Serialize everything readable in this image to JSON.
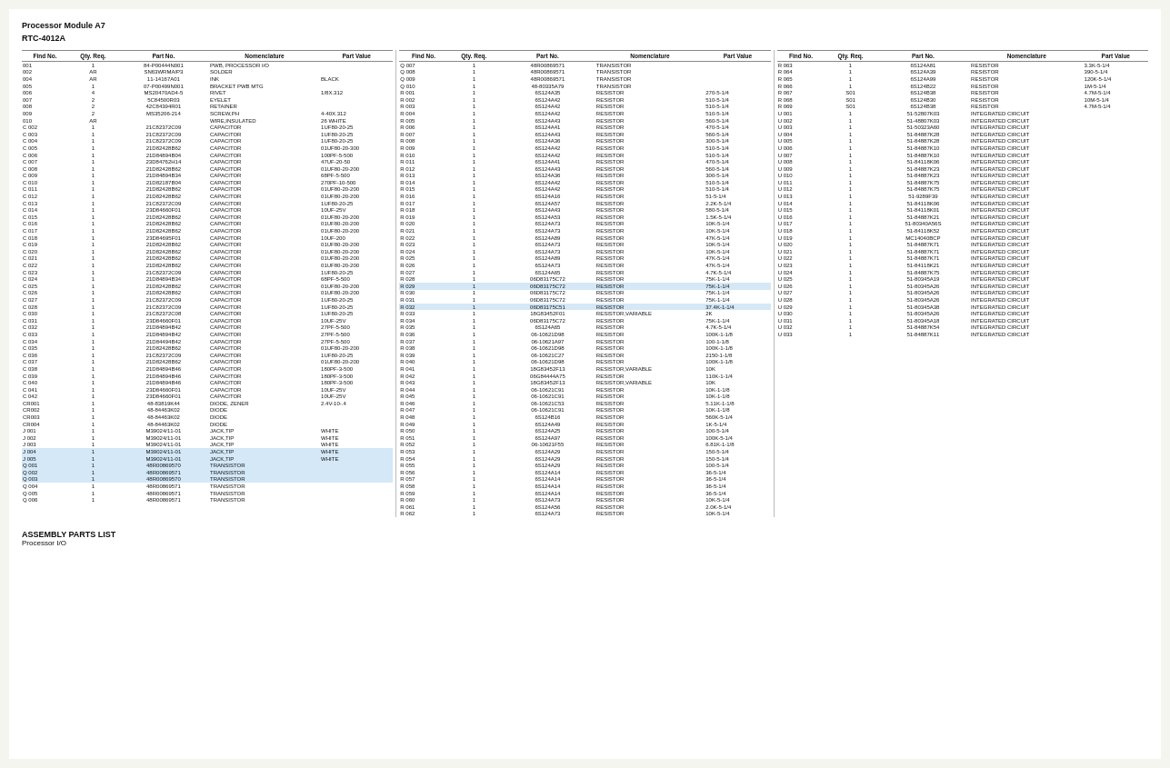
{
  "title": "Processor Module A7",
  "subtitle": "RTC-4012A",
  "column_headers": {
    "find_no": "Find No.",
    "qty_req": "Qty. Req.",
    "part_no": "Part No.",
    "nomenclature": "Nomenclature",
    "part_value": "Part Value"
  },
  "footer": {
    "main": "ASSEMBLY PARTS LIST",
    "sub": "Processor I/O"
  },
  "col1_rows": [
    [
      "001",
      "1",
      "84-P00444N001",
      "PWB, PROCESSOR I/O",
      ""
    ],
    [
      "002",
      "AR",
      "SN63WRMA/P3",
      "SOLDER",
      ""
    ],
    [
      "004",
      "AR",
      "11-14167A01",
      "INK",
      "BLACK"
    ],
    [
      "005",
      "1",
      "07-P00499N001",
      "BRACKET PWB MTG",
      ""
    ],
    [
      "006",
      "4",
      "MS20470AD4-5",
      "RIVET",
      "1/8X.312"
    ],
    [
      "007",
      "2",
      "5C84500R03",
      "EYELET",
      ""
    ],
    [
      "008",
      "2",
      "42C84394R01",
      "RETAINER",
      ""
    ],
    [
      "009",
      "2",
      "MS35206-214",
      "SCREW,PH",
      "4-40X.312"
    ],
    [
      "010",
      "AR",
      "",
      "WIRE,INSULATED",
      "26 WHITE"
    ],
    [
      "C 002",
      "1",
      "21C82372C09",
      "CAPACITOR",
      "1UF80-20-25"
    ],
    [
      "C 003",
      "1",
      "21C82372C09",
      "CAPACITOR",
      "1UF80-20-25"
    ],
    [
      "C 004",
      "1",
      "21C82372C09",
      "CAPACITOR",
      "1UF80-20-25"
    ],
    [
      "C 005",
      "1",
      "21D82428B62",
      "CAPACITOR",
      "01UF80-20-300"
    ],
    [
      "C 006",
      "1",
      "21D84894B04",
      "CAPACITOR",
      "100PF-5-500"
    ],
    [
      "C 007",
      "1",
      "23D84762H14",
      "CAPACITOR",
      "47UF-20-50"
    ],
    [
      "C 008",
      "1",
      "21D82428B62",
      "CAPACITOR",
      "01UF80-20-200"
    ],
    [
      "C 009",
      "1",
      "21D84894B34",
      "CAPACITOR",
      "68PF-5-500"
    ],
    [
      "C 010",
      "1",
      "21D82187B04",
      "CAPACITOR",
      "270PF-10-500"
    ],
    [
      "C 011",
      "1",
      "21D82428B62",
      "CAPACITOR",
      "01UF80-20-200"
    ],
    [
      "C 012",
      "1",
      "21D82428B62",
      "CAPACITOR",
      "01UF80-20-200"
    ],
    [
      "C 013",
      "1",
      "21C82372C09",
      "CAPACITOR",
      "1UF80-20-25"
    ],
    [
      "C 014",
      "1",
      "23D84660F01",
      "CAPACITOR",
      "10UF-25V"
    ],
    [
      "C 015",
      "1",
      "21D82428B62",
      "CAPACITOR",
      "01UF80-20-200"
    ],
    [
      "C 016",
      "1",
      "21D82428B62",
      "CAPACITOR",
      "01UF80-20-200"
    ],
    [
      "C 017",
      "1",
      "21D82428B62",
      "CAPACITOR",
      "01UF80-20-200"
    ],
    [
      "C 018",
      "1",
      "23D84695F01",
      "CAPACITOR",
      "10UF-200"
    ],
    [
      "C 019",
      "1",
      "21D82428B62",
      "CAPACITOR",
      "01UF80-20-200"
    ],
    [
      "C 020",
      "1",
      "21D82428B62",
      "CAPACITOR",
      "01UF80-20-200"
    ],
    [
      "C 021",
      "1",
      "21D82428B62",
      "CAPACITOR",
      "01UF80-20-200"
    ],
    [
      "C 022",
      "1",
      "21D82428B62",
      "CAPACITOR",
      "01UF80-20-200"
    ],
    [
      "C 023",
      "1",
      "21C82372C09",
      "CAPACITOR",
      "1UF80-20-25"
    ],
    [
      "C 024",
      "1",
      "21D84894B34",
      "CAPACITOR",
      "68PF-5-500"
    ],
    [
      "C 025",
      "1",
      "21D82428B62",
      "CAPACITOR",
      "01UF80-20-200"
    ],
    [
      "C 026",
      "1",
      "21D82428B62",
      "CAPACITOR",
      "01UF80-20-200"
    ],
    [
      "C 027",
      "1",
      "21C82372C09",
      "CAPACITOR",
      "1UF80-20-25"
    ],
    [
      "C 028",
      "1",
      "21C82372C09",
      "CAPACITOR",
      "1UF80-20-25"
    ],
    [
      "C 030",
      "1",
      "21C82372C08",
      "CAPACITOR",
      "1UF80-20-25"
    ],
    [
      "C 031",
      "1",
      "23D84660F01",
      "CAPACITOR",
      "10UF-25V"
    ],
    [
      "C 032",
      "1",
      "21D84894B42",
      "CAPACITOR",
      "27PF-5-500"
    ],
    [
      "C 033",
      "1",
      "21D84894B42",
      "CAPACITOR",
      "27PF-5-500"
    ],
    [
      "C 034",
      "1",
      "21D84494B42",
      "CAPACITOR",
      "27PF-5-500"
    ],
    [
      "C 035",
      "1",
      "21D82428B62",
      "CAPACITOR",
      "01UF80-20-200"
    ],
    [
      "C 036",
      "1",
      "21C82372C09",
      "CAPACITOR",
      "1UF80-20-25"
    ],
    [
      "C 037",
      "1",
      "21D82428B62",
      "CAPACITOR",
      "01UF80-20-200"
    ],
    [
      "C 038",
      "1",
      "21D84894B46",
      "CAPACITOR",
      "180PF-3-500"
    ],
    [
      "C 039",
      "1",
      "21D84894B46",
      "CAPACITOR",
      "180PF-3-500"
    ],
    [
      "C 040",
      "1",
      "21D84894B46",
      "CAPACITOR",
      "180PF-3-500"
    ],
    [
      "C 041",
      "1",
      "23D84660F01",
      "CAPACITOR",
      "10UF-25V"
    ],
    [
      "C 042",
      "1",
      "23D84660F01",
      "CAPACITOR",
      "10UF-25V"
    ],
    [
      "CR001",
      "1",
      "48-83819K44",
      "DIODE, ZENER",
      "2.4V-10-.4"
    ],
    [
      "CR002",
      "1",
      "48-84463K02",
      "DIODE",
      ""
    ],
    [
      "CR003",
      "1",
      "48-84463K02",
      "DIODE",
      ""
    ],
    [
      "CR004",
      "1",
      "48-84463K02",
      "DIODE",
      ""
    ],
    [
      "J 001",
      "1",
      "M39024/11-01",
      "JACK,TIP",
      "WHITE"
    ],
    [
      "J 002",
      "1",
      "M39024/11-01",
      "JACK,TIP",
      "WHITE"
    ],
    [
      "J 003",
      "1",
      "M39024/11-01",
      "JACK,TIP",
      "WHITE"
    ],
    [
      "J 004",
      "1",
      "M39024/11-01",
      "JACK,TIP",
      "WHITE"
    ],
    [
      "J 005",
      "1",
      "M39024/11-01",
      "JACK,TIP",
      "WHITE"
    ],
    [
      "Q 001",
      "1",
      "48R00869570",
      "TRANSISTOR",
      ""
    ],
    [
      "Q 002",
      "1",
      "48R00869571",
      "TRANSISTOR",
      ""
    ],
    [
      "Q 003",
      "1",
      "48R00869570",
      "TRANSISTOR",
      ""
    ],
    [
      "Q 004",
      "1",
      "48R00869571",
      "TRANSISTOR",
      ""
    ],
    [
      "Q 005",
      "1",
      "48R00869571",
      "TRANSISTOR",
      ""
    ],
    [
      "Q 006",
      "1",
      "48R00869571",
      "TRANSISTOR",
      ""
    ]
  ],
  "col2_rows": [
    [
      "Q 007",
      "1",
      "48R00869571",
      "TRANSISTOR",
      ""
    ],
    [
      "Q 008",
      "1",
      "48R00869571",
      "TRANSISTOR",
      ""
    ],
    [
      "Q 009",
      "1",
      "48R00869571",
      "TRANSISTOR",
      ""
    ],
    [
      "Q 010",
      "1",
      "48-80335A79",
      "TRANSISTOR",
      ""
    ],
    [
      "R 001",
      "1",
      "6S124A35",
      "RESISTOR",
      "270-5-1/4"
    ],
    [
      "R 002",
      "1",
      "6S124A42",
      "RESISTOR",
      "510-5-1/4"
    ],
    [
      "R 003",
      "1",
      "6S124A42",
      "RESISTOR",
      "510-5-1/4"
    ],
    [
      "R 004",
      "1",
      "6S124A42",
      "RESISTOR",
      "510-5-1/4"
    ],
    [
      "R 005",
      "1",
      "6S124A43",
      "RESISTOR",
      "560-5-1/4"
    ],
    [
      "R 006",
      "1",
      "6S124A41",
      "RESISTOR",
      "470-5-1/4"
    ],
    [
      "R 007",
      "1",
      "6S124A43",
      "RESISTOR",
      "560-5-1/4"
    ],
    [
      "R 008",
      "1",
      "6S124A36",
      "RESISTOR",
      "300-5-1/4"
    ],
    [
      "R 009",
      "1",
      "6S124A42",
      "RESISTOR",
      "510-5-1/4"
    ],
    [
      "R 010",
      "1",
      "6S124A42",
      "RESISTOR",
      "510-5-1/4"
    ],
    [
      "R 011",
      "1",
      "6S124A41",
      "RESISTOR",
      "470-5-1/4"
    ],
    [
      "R 012",
      "1",
      "6S124A43",
      "RESISTOR",
      "560-5-1/4"
    ],
    [
      "R 013",
      "1",
      "6S124A36",
      "RESISTOR",
      "300-5-1/4"
    ],
    [
      "R 014",
      "1",
      "6S124A42",
      "RESISTOR",
      "510-5-1/4"
    ],
    [
      "R 015",
      "1",
      "6S124A42",
      "RESISTOR",
      "510-5-1/4"
    ],
    [
      "R 016",
      "1",
      "6S124A16",
      "RESISTOR",
      "51-5-1/4"
    ],
    [
      "R 017",
      "1",
      "6S124A57",
      "RESISTOR",
      "2.2K-5-1/4"
    ],
    [
      "R 018",
      "1",
      "6S124A43",
      "RESISTOR",
      "580-5-1/4"
    ],
    [
      "R 019",
      "1",
      "6S124A53",
      "RESISTOR",
      "1.5K-5-1/4"
    ],
    [
      "R 020",
      "1",
      "6S124A73",
      "RESISTOR",
      "10K-5-1/4"
    ],
    [
      "R 021",
      "1",
      "6S124A73",
      "RESISTOR",
      "10K-5-1/4"
    ],
    [
      "R 022",
      "1",
      "6S124A89",
      "RESISTOR",
      "47K-5-1/4"
    ],
    [
      "R 023",
      "1",
      "6S124A73",
      "RESISTOR",
      "10K-5-1/4"
    ],
    [
      "R 024",
      "1",
      "6S124A73",
      "RESISTOR",
      "10K-5-1/4"
    ],
    [
      "R 025",
      "1",
      "6S124A89",
      "RESISTOR",
      "47K-5-1/4"
    ],
    [
      "R 026",
      "1",
      "6S124A73",
      "RESISTOR",
      "47K-5-1/4"
    ],
    [
      "R 027",
      "1",
      "6S124A65",
      "RESISTOR",
      "4.7K-5-1/4"
    ],
    [
      "R 028",
      "1",
      "06D83175C72",
      "RESISTOR",
      "75K-1-1/4"
    ],
    [
      "R 029",
      "1",
      "06D83175C72",
      "RESISTOR",
      "75K-1-1/4"
    ],
    [
      "R 030",
      "1",
      "06D83175C72",
      "RESISTOR",
      "75K-1-1/4"
    ],
    [
      "R 031",
      "1",
      "06D83175C72",
      "RESISTOR",
      "75K-1-1/4"
    ],
    [
      "R 032",
      "1",
      "06D83175C51",
      "RESISTOR",
      "37.4K-1-1/4"
    ],
    [
      "R 033",
      "1",
      "18G83452F01",
      "RESISTOR,VARIABLE",
      "2K"
    ],
    [
      "R 034",
      "1",
      "06D83175C72",
      "RESISTOR",
      "75K-1-1/4"
    ],
    [
      "R 035",
      "1",
      "6S124A65",
      "RESISTOR",
      "4.7K-5-1/4"
    ],
    [
      "R 036",
      "1",
      "06-10621D98",
      "RESISTOR",
      "100K-1-1/8"
    ],
    [
      "R 037",
      "1",
      "06-10621A97",
      "RESISTOR",
      "100-1-1/8"
    ],
    [
      "R 038",
      "1",
      "06-10621D98",
      "RESISTOR",
      "100K-1-1/8"
    ],
    [
      "R 039",
      "1",
      "06-10621C27",
      "RESISTOR",
      "2150-1-1/8"
    ],
    [
      "R 040",
      "1",
      "06-10621D98",
      "RESISTOR",
      "100K-1-1/8"
    ],
    [
      "R 041",
      "1",
      "18G83452F13",
      "RESISTOR,VARIABLE",
      "10K"
    ],
    [
      "R 042",
      "1",
      "06G84444A75",
      "RESISTOR",
      "110K-1-1/4"
    ],
    [
      "R 043",
      "1",
      "18G83452F13",
      "RESISTOR,VARIABLE",
      "10K"
    ],
    [
      "R 044",
      "1",
      "06-10621C91",
      "RESISTOR",
      "10K-1-1/8"
    ],
    [
      "R 045",
      "1",
      "06-10621C91",
      "RESISTOR",
      "10K-1-1/8"
    ],
    [
      "R 046",
      "1",
      "06-10621C53",
      "RESISTOR",
      "5.11K-1-1/8"
    ],
    [
      "R 047",
      "1",
      "06-10621C91",
      "RESISTOR",
      "10K-1-1/8"
    ],
    [
      "R 048",
      "1",
      "6S124B16",
      "RESISTOR",
      "560K-5-1/4"
    ],
    [
      "R 049",
      "1",
      "6S124A49",
      "RESISTOR",
      "1K-5-1/4"
    ],
    [
      "R 050",
      "1",
      "6S124A25",
      "RESISTOR",
      "100-5-1/4"
    ],
    [
      "R 051",
      "1",
      "6S124A97",
      "RESISTOR",
      "100K-5-1/4"
    ],
    [
      "R 052",
      "1",
      "06-10621F55",
      "RESISTOR",
      "6.81K-1-1/8"
    ],
    [
      "R 053",
      "1",
      "6S124A29",
      "RESISTOR",
      "150-5-1/4"
    ],
    [
      "R 054",
      "1",
      "6S124A29",
      "RESISTOR",
      "150-5-1/4"
    ],
    [
      "R 055",
      "1",
      "6S124A29",
      "RESISTOR",
      "100-5-1/4"
    ],
    [
      "R 056",
      "1",
      "6S124A14",
      "RESISTOR",
      "36-5-1/4"
    ],
    [
      "R 057",
      "1",
      "6S124A14",
      "RESISTOR",
      "36-5-1/4"
    ],
    [
      "R 058",
      "1",
      "6S124A14",
      "RESISTOR",
      "36-5-1/4"
    ],
    [
      "R 059",
      "1",
      "6S124A14",
      "RESISTOR",
      "36-5-1/4"
    ],
    [
      "R 060",
      "1",
      "6S124A73",
      "RESISTOR",
      "10K-5-1/4"
    ],
    [
      "R 061",
      "1",
      "6S124A56",
      "RESISTOR",
      "2.0K-5-1/4"
    ],
    [
      "R 062",
      "1",
      "6S124A73",
      "RESISTOR",
      "10K-5-1/4"
    ]
  ],
  "col3_rows": [
    [
      "R 063",
      "1",
      "6S124A81",
      "RESISTOR",
      "3.3K-5-1/4"
    ],
    [
      "R 064",
      "1",
      "6S124A39",
      "RESISTOR",
      "390-5-1/4"
    ],
    [
      "R 065",
      "1",
      "6S124A99",
      "RESISTOR",
      "120K-5-1/4"
    ],
    [
      "R 066",
      "1",
      "6S124B22",
      "RESISTOR",
      "1M-5-1/4"
    ],
    [
      "R 067",
      "S01",
      "6S124B38",
      "RESISTOR",
      "4.7M-5-1/4"
    ],
    [
      "R 068",
      "S01",
      "6S124B30",
      "RESISTOR",
      "10M-5-1/4"
    ],
    [
      "R 069",
      "S01",
      "6S124B38",
      "RESISTOR",
      "4.7M-5-1/4"
    ],
    [
      "U 001",
      "1",
      "51-52807K03",
      "INTEGRATED CIRCUIT",
      ""
    ],
    [
      "U 002",
      "1",
      "51-48807K03",
      "INTEGRATED CIRCUIT",
      ""
    ],
    [
      "U 003",
      "1",
      "51-50323A60",
      "INTEGRATED CIRCUIT",
      ""
    ],
    [
      "U 004",
      "1",
      "51-84887K28",
      "INTEGRATED CIRCUIT",
      ""
    ],
    [
      "U 005",
      "1",
      "51-84887K28",
      "INTEGRATED CIRCUIT",
      ""
    ],
    [
      "U 006",
      "1",
      "51-84887K10",
      "INTEGRATED CIRCUIT",
      ""
    ],
    [
      "U 007",
      "1",
      "51-84887K10",
      "INTEGRATED CIRCUIT",
      ""
    ],
    [
      "U 008",
      "1",
      "51-84118K06",
      "INTEGRATED CIRCUIT",
      ""
    ],
    [
      "U 009",
      "1",
      "51-84887K23",
      "INTEGRATED CIRCUIT",
      ""
    ],
    [
      "U 010",
      "1",
      "51-84887K23",
      "INTEGRATED CIRCUIT",
      ""
    ],
    [
      "U 011",
      "1",
      "51-84887K75",
      "INTEGRATED CIRCUIT",
      ""
    ],
    [
      "U 012",
      "1",
      "51-84887K75",
      "INTEGRATED CIRCUIT",
      ""
    ],
    [
      "U 013",
      "1",
      "51-9289F39",
      "INTEGRATED CIRCUIT",
      ""
    ],
    [
      "U 014",
      "1",
      "51-84118K06",
      "INTEGRATED CIRCUIT",
      ""
    ],
    [
      "U 015",
      "1",
      "51-84118K01",
      "INTEGRATED CIRCUIT",
      ""
    ],
    [
      "U 016",
      "1",
      "51-84887K21",
      "INTEGRATED CIRCUIT",
      ""
    ],
    [
      "U 017",
      "1",
      "51-80340A56S",
      "INTEGRATED CIRCUIT",
      ""
    ],
    [
      "U 018",
      "1",
      "51-84118K52",
      "INTEGRATED CIRCUIT",
      ""
    ],
    [
      "U 019",
      "1",
      "MC14040BCP",
      "INTEGRATED CIRCUIT",
      ""
    ],
    [
      "U 020",
      "1",
      "51-84887K71",
      "INTEGRATED CIRCUIT",
      ""
    ],
    [
      "U 021",
      "1",
      "51-84887K71",
      "INTEGRATED CIRCUIT",
      ""
    ],
    [
      "U 022",
      "1",
      "51-84887K71",
      "INTEGRATED CIRCUIT",
      ""
    ],
    [
      "U 023",
      "1",
      "51-84118K21",
      "INTEGRATED CIRCUIT",
      ""
    ],
    [
      "U 024",
      "1",
      "51-84887K75",
      "INTEGRATED CIRCUIT",
      ""
    ],
    [
      "U 025",
      "1",
      "51-80345A19",
      "INTEGRATED CIRCUIT",
      ""
    ],
    [
      "U 026",
      "1",
      "51-80345A26",
      "INTEGRATED CIRCUIT",
      ""
    ],
    [
      "U 027",
      "1",
      "51-80345A26",
      "INTEGRATED CIRCUIT",
      ""
    ],
    [
      "U 028",
      "1",
      "51-80345A26",
      "INTEGRATED CIRCUIT",
      ""
    ],
    [
      "U 029",
      "1",
      "51-80345A38",
      "INTEGRATED CIRCUIT",
      ""
    ],
    [
      "U 030",
      "1",
      "51-80345A26",
      "INTEGRATED CIRCUIT",
      ""
    ],
    [
      "U 031",
      "1",
      "51-80345A18",
      "INTEGRATED CIRCUIT",
      ""
    ],
    [
      "U 032",
      "1",
      "51-84887K54",
      "INTEGRATED CIRCUIT",
      ""
    ],
    [
      "U 033",
      "1",
      "51-84887K11",
      "INTEGRATED CIRCUIT",
      ""
    ]
  ]
}
